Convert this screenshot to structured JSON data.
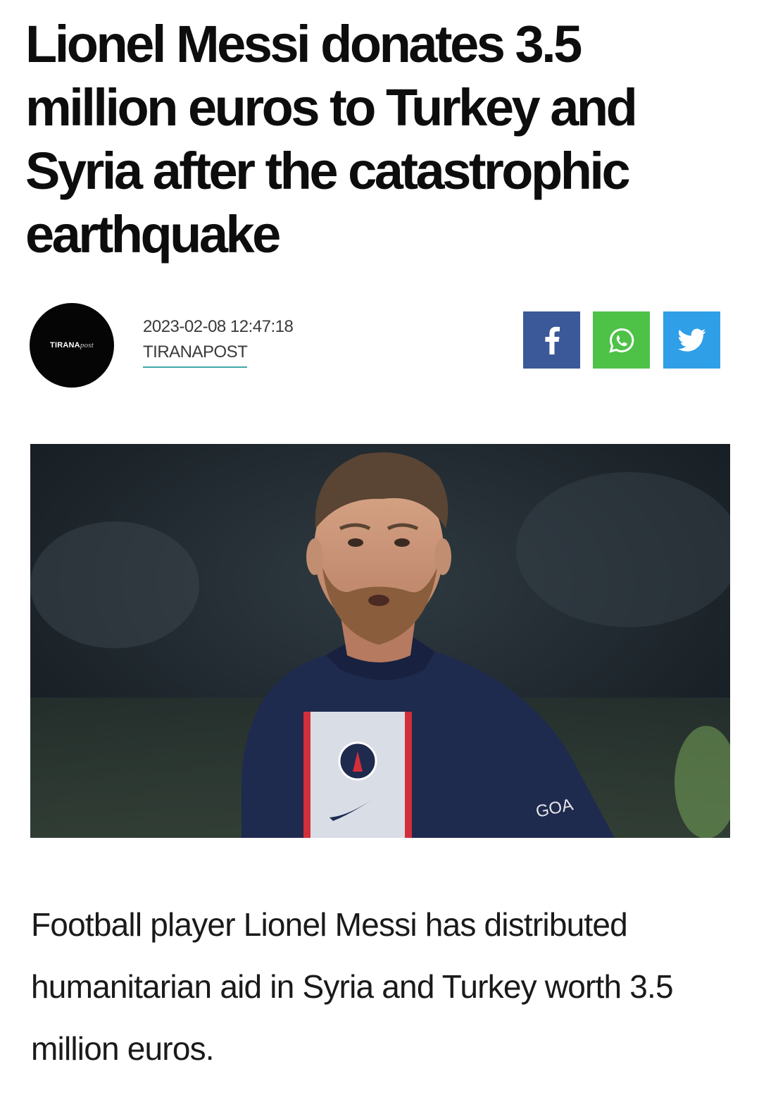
{
  "article": {
    "headline": "Lionel Messi donates 3.5 million euros to Turkey and Syria after the catastrophic earthquake",
    "date": "2023-02-08 12:47:18",
    "author": "TIRANAPOST",
    "logo": {
      "bold": "TIRANA",
      "script": "post"
    },
    "body": "Football player Lionel Messi has distributed humanitarian aid in Syria and Turkey worth 3.5 million euros."
  },
  "share": [
    {
      "name": "facebook",
      "icon": "facebook-icon",
      "color": "#3b5998"
    },
    {
      "name": "whatsapp",
      "icon": "whatsapp-icon",
      "color": "#4dc247"
    },
    {
      "name": "twitter",
      "icon": "twitter-icon",
      "color": "#2f9fe8"
    }
  ],
  "photo": {
    "kit_text": "GOA"
  }
}
